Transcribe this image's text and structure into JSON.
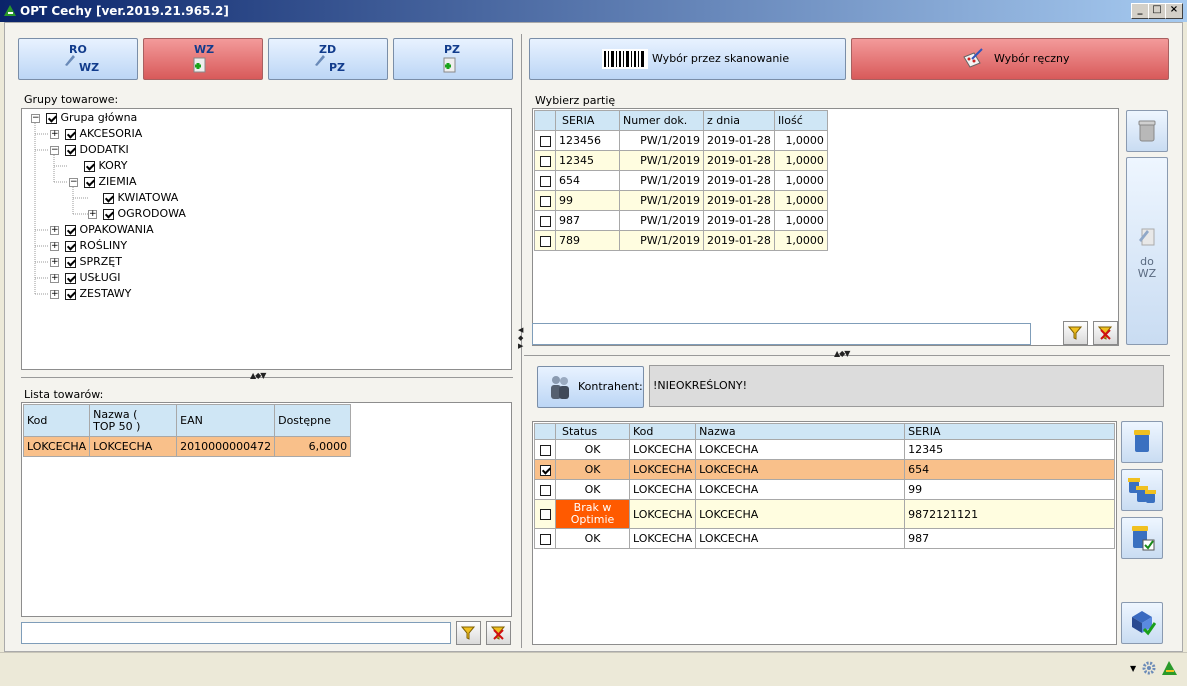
{
  "window": {
    "title": "OPT Cechy [ver.2019.21.965.2]"
  },
  "toolbar": {
    "ro_wz_top": "RO",
    "ro_wz_bottom": "WZ",
    "wz_top": "WZ",
    "zd_pz_top": "ZD",
    "zd_pz_bottom": "PZ",
    "pz_top": "PZ",
    "scan_label": "Wybór przez skanowanie",
    "manual_label": "Wybór ręczny"
  },
  "groups": {
    "caption": "Grupy towarowe:",
    "root": "Grupa główna",
    "items": [
      "AKCESORIA",
      "DODATKI",
      "KORY",
      "ZIEMIA",
      "KWIATOWA",
      "OGRODOWA",
      "OPAKOWANIA",
      "ROŚLINY",
      "SPRZĘT",
      "USŁUGI",
      "ZESTAWY"
    ]
  },
  "products": {
    "caption": "Lista towarów:",
    "columns": [
      "Kod",
      "Nazwa ( TOP 50 )",
      "EAN",
      "Dostępne"
    ],
    "col2a": "Nazwa (",
    "col2b": "TOP 50 )",
    "rows": [
      [
        "LOKCECHA",
        "LOKCECHA",
        "2010000000472",
        "6,0000"
      ]
    ]
  },
  "batches": {
    "caption": "Wybierz partię",
    "columns": [
      "SERIA",
      "Numer dok.",
      "z dnia",
      "Ilość"
    ],
    "rows": [
      [
        "123456",
        "PW/1/2019",
        "2019-01-28",
        "1,0000"
      ],
      [
        "12345",
        "PW/1/2019",
        "2019-01-28",
        "1,0000"
      ],
      [
        "654",
        "PW/1/2019",
        "2019-01-28",
        "1,0000"
      ],
      [
        "99",
        "PW/1/2019",
        "2019-01-28",
        "1,0000"
      ],
      [
        "987",
        "PW/1/2019",
        "2019-01-28",
        "1,0000"
      ],
      [
        "789",
        "PW/1/2019",
        "2019-01-28",
        "1,0000"
      ]
    ]
  },
  "do_wz": {
    "line1": "do",
    "line2": "WZ"
  },
  "contractor": {
    "button_label": "Kontrahent:",
    "value": "!NIEOKREŚLONY!"
  },
  "selected": {
    "columns": [
      "Status",
      "Kod",
      "Nazwa",
      "SERIA"
    ],
    "rows": [
      {
        "checked": false,
        "status": "OK",
        "kod": "LOKCECHA",
        "nazwa": "LOKCECHA",
        "seria": "12345"
      },
      {
        "checked": true,
        "status": "OK",
        "kod": "LOKCECHA",
        "nazwa": "LOKCECHA",
        "seria": "654"
      },
      {
        "checked": false,
        "status": "OK",
        "kod": "LOKCECHA",
        "nazwa": "LOKCECHA",
        "seria": "99"
      },
      {
        "checked": false,
        "status": "Brak w Optimie",
        "kod": "LOKCECHA",
        "nazwa": "LOKCECHA",
        "seria": "9872121121"
      },
      {
        "checked": false,
        "status": "OK",
        "kod": "LOKCECHA",
        "nazwa": "LOKCECHA",
        "seria": "987"
      }
    ],
    "brak_line1": "Brak w",
    "brak_line2": "Optimie"
  },
  "colors": {
    "accent_red": "#d85a5a",
    "header_blue": "#cfe6f5",
    "row_selected": "#f9c08a",
    "row_alt": "#fffde0",
    "status_error": "#ff5a00"
  }
}
